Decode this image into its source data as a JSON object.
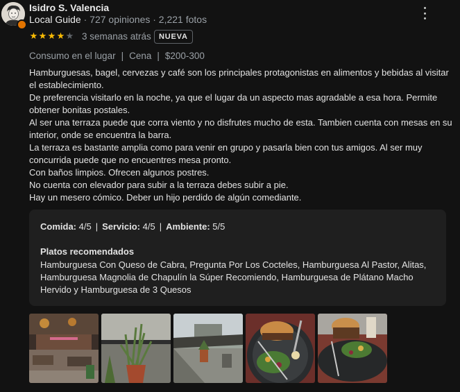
{
  "reviewer": {
    "name": "Isidro S. Valencia",
    "level": "Local Guide",
    "stats": "727 opiniones · 2,221 fotos",
    "avatar_icon": "user-avatar",
    "badge_icon": "local-guide-star-icon"
  },
  "review": {
    "rating": 4,
    "max_rating": 5,
    "time": "3 semanas atrás",
    "badge": "NUEVA",
    "visit": {
      "service": "Consumo en el lugar",
      "meal": "Cena",
      "price": "$200-300"
    },
    "text": [
      "Hamburguesas, bagel, cervezas y café son los principales protagonistas en alimentos y bebidas al visitar el establecimiento.",
      "De preferencia visitarlo en la noche, ya que el lugar da un aspecto mas agradable a esa hora. Permite obtener bonitas postales.",
      "Al ser una terraza puede que corra viento y no disfrutes mucho de esta. Tambien cuenta con mesas en su interior, onde se encuentra la barra.",
      "La terraza es bastante amplia como para venir en grupo y pasarla bien con tus amigos. Al ser muy concurrida puede que no encuentres mesa pronto.",
      "Con baños limpios. Ofrecen algunos postres.",
      "No cuenta con elevador para subir a la terraza debes subir a pie.",
      "Hay un mesero cómico. Deber un hijo perdido de algún comediante."
    ],
    "ratings": {
      "food_label": "Comida:",
      "food_value": "4/5",
      "service_label": "Servicio:",
      "service_value": "4/5",
      "ambience_label": "Ambiente:",
      "ambience_value": "5/5",
      "separator": "|"
    },
    "recommended": {
      "title": "Platos recomendados",
      "text": "Hamburguesa Con Queso de Cabra, Pregunta Por Los Cocteles, Hamburguesa Al Pastor, Alitas, Hamburguesa Magnolia de Chapulín la Súper Recomiendo, Hamburguesa de Plátano Macho Hervido y Hamburguesa de 3 Quesos"
    },
    "photos": [
      "terrace-bar-photo",
      "plant-pot-photo",
      "terrace-view-photo",
      "burger-salad-photo",
      "burger-plate-photo"
    ]
  },
  "colors": {
    "background": "#121212",
    "star_on": "#fbbc04",
    "star_off": "#5f6368",
    "muted_text": "#9aa0a6",
    "card": "#1f1f1f",
    "guide_badge": "#e37400"
  },
  "menu_icon": "more-vert-icon"
}
